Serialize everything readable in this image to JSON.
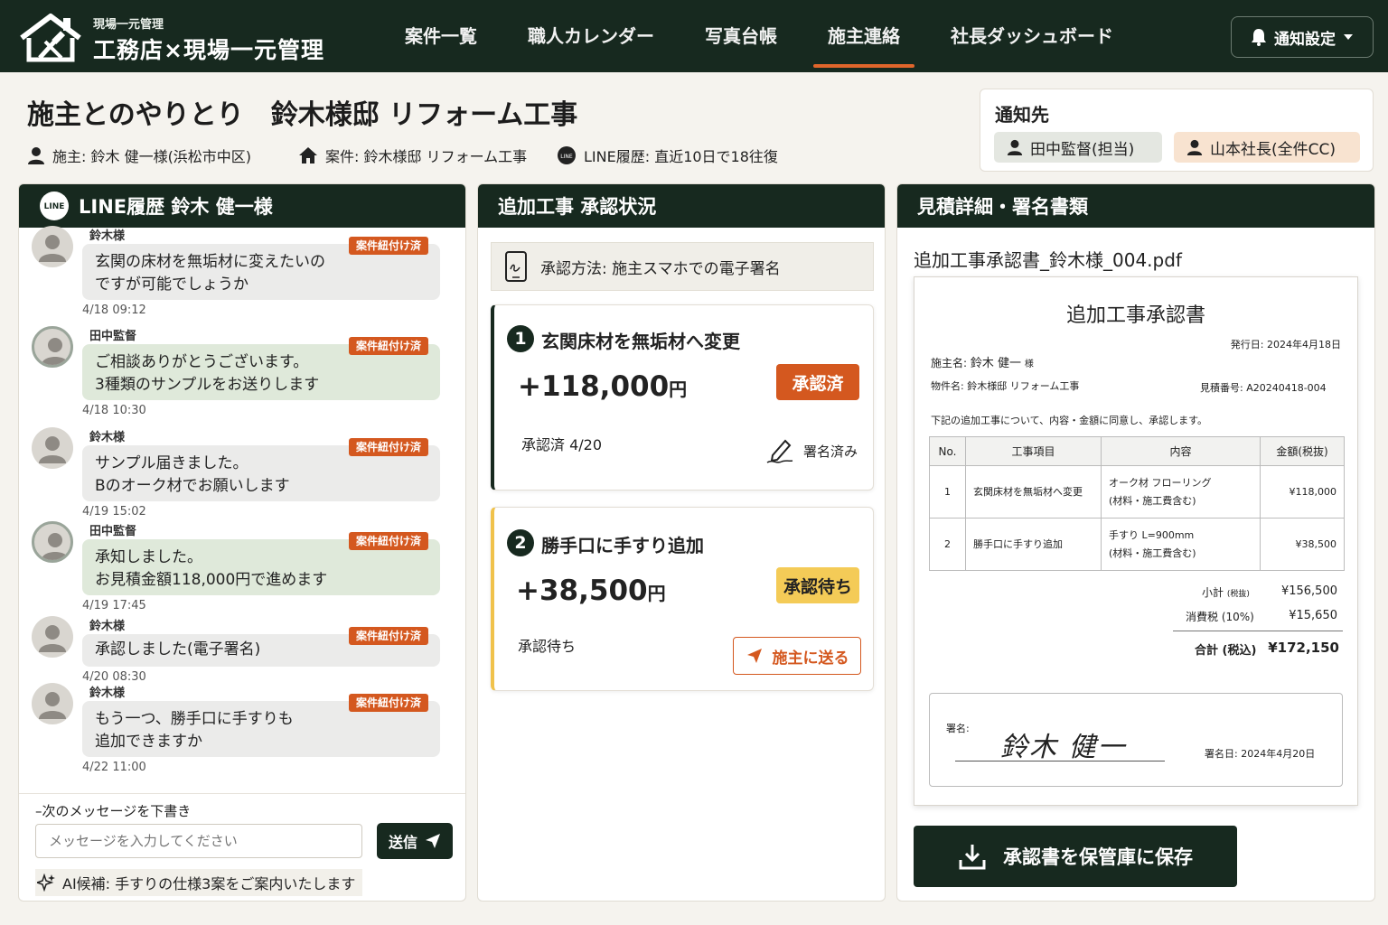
{
  "app": {
    "brand_sub": "現場一元管理",
    "brand_main": "工務店×現場一元管理"
  },
  "nav": {
    "items": [
      "案件一覧",
      "職人カレンダー",
      "写真台帳",
      "施主連絡",
      "社長ダッシュボード"
    ],
    "active_index": 3,
    "notify_label": "通知設定"
  },
  "page": {
    "title": "施主とのやりとり　鈴木様邸 リフォーム工事",
    "owner": "施主: 鈴木 健一様(浜松市中区)",
    "project": "案件: 鈴木様邸 リフォーム工事",
    "line_history": "LINE履歴: 直近10日で18往復"
  },
  "notify_card": {
    "title": "通知先",
    "chips": [
      "田中監督(担当)",
      "山本社長(全件CC)"
    ]
  },
  "chat": {
    "header": "LINE履歴 鈴木 健一様",
    "line_icon_text": "LINE",
    "messages": [
      {
        "sender": "鈴木様",
        "role": "cust",
        "lines": [
          "玄関の床材を無垢材に変えたいの",
          "ですが可能でしょうか"
        ],
        "tag": "案件紐付け済",
        "time": "4/18 09:12"
      },
      {
        "sender": "田中監督",
        "role": "staff",
        "lines": [
          "ご相談ありがとうございます。",
          "3種類のサンプルをお送りします"
        ],
        "tag": "案件紐付け済",
        "time": "4/18 10:30"
      },
      {
        "sender": "鈴木様",
        "role": "cust",
        "lines": [
          "サンプル届きました。",
          "Bのオーク材でお願いします"
        ],
        "tag": "案件紐付け済",
        "time": "4/19 15:02"
      },
      {
        "sender": "田中監督",
        "role": "staff",
        "lines": [
          "承知しました。",
          "お見積金額118,000円で進めます"
        ],
        "tag": "案件紐付け済",
        "time": "4/19 17:45"
      },
      {
        "sender": "鈴木様",
        "role": "cust",
        "lines": [
          "承認しました(電子署名)"
        ],
        "tag": "案件紐付け済",
        "time": "4/20 08:30"
      },
      {
        "sender": "鈴木様",
        "role": "cust",
        "lines": [
          "もう一つ、勝手口に手すりも",
          "追加できますか"
        ],
        "tag": "案件紐付け済",
        "time": "4/22 11:00"
      }
    ],
    "compose_label": "次のメッセージを下書き",
    "compose_placeholder": "メッセージを入力してください",
    "send_label": "送信",
    "ai_hint": "AI候補: 手すりの仕様3案をご案内いたします"
  },
  "approval": {
    "header": "追加工事 承認状況",
    "method": "承認方法: 施主スマホでの電子署名",
    "items": [
      {
        "no": "1",
        "title": "玄関床材を無垢材へ変更",
        "amount": "+118,000",
        "yen": "円",
        "status": "承認済",
        "sub": "承認済  4/20",
        "sign_label": "署名済み"
      },
      {
        "no": "2",
        "title": "勝手口に手すり追加",
        "amount": "+38,500",
        "yen": "円",
        "status": "承認待ち",
        "sub": "承認待ち",
        "send_label": "施主に送る"
      }
    ]
  },
  "document": {
    "header": "見積詳細・署名書類",
    "file_name": "追加工事承認書_鈴木様_004.pdf",
    "title": "追加工事承認書",
    "issue_date": "発行日: 2024年4月18日",
    "owner_label": "施主名:",
    "owner_name": "鈴木 健一",
    "owner_suffix": "様",
    "property": "物件名: 鈴木様邸 リフォーム工事",
    "estimate_no": "見積番号: A20240418-004",
    "agreement": "下記の追加工事について、内容・金額に同意し、承認します。",
    "table_headers": [
      "No.",
      "工事項目",
      "内容",
      "金額(税抜)"
    ],
    "rows": [
      {
        "no": "1",
        "item": "玄関床材を無垢材へ変更",
        "content1": "オーク材 フローリング",
        "content2": "(材料・施工費含む)",
        "amount": "¥118,000"
      },
      {
        "no": "2",
        "item": "勝手口に手すり追加",
        "content1": "手すり L=900mm",
        "content2": "(材料・施工費含む)",
        "amount": "¥38,500"
      }
    ],
    "subtotal_label": "小計",
    "subtotal_note": "(税抜)",
    "subtotal": "¥156,500",
    "tax_label": "消費税 (10%)",
    "tax": "¥15,650",
    "total_label": "合計 (税込)",
    "total": "¥172,150",
    "sign_label": "署名:",
    "signature": "鈴木 健一",
    "sign_date": "署名日: 2024年4月20日",
    "save_label": "承認書を保管庫に保存"
  },
  "colors": {
    "dark_green": "#17291f",
    "accent_orange": "#e0652b",
    "tag_orange": "#d4581f",
    "pending_yellow": "#f0c24b"
  }
}
